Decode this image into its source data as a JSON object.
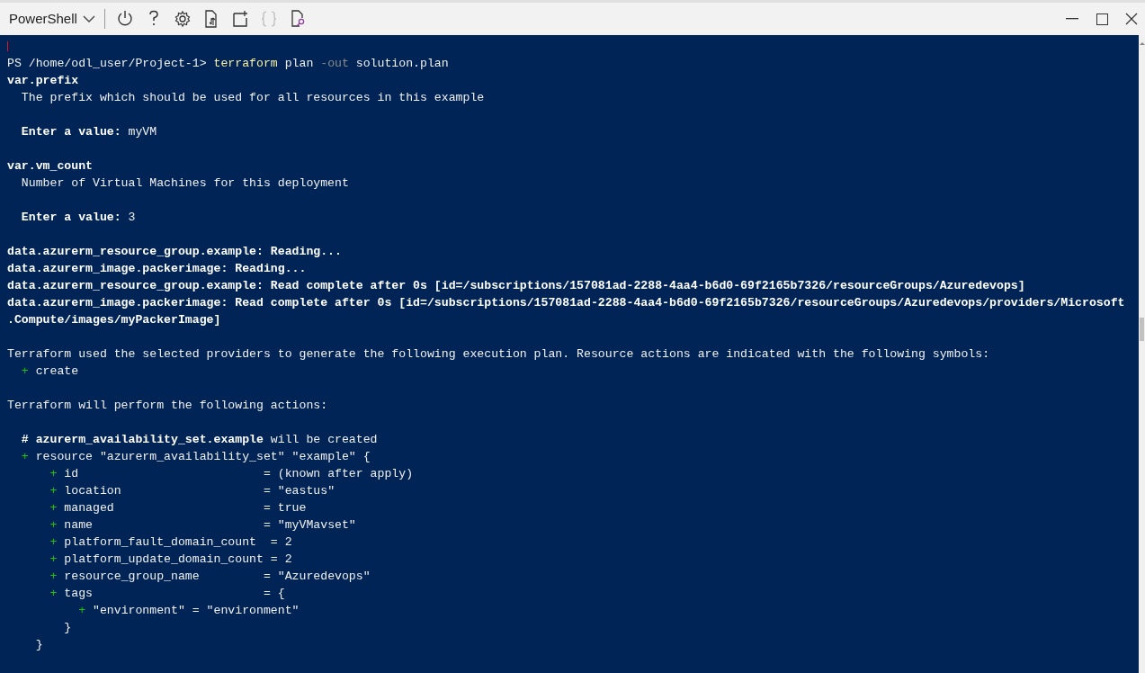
{
  "toolbar": {
    "shell_selector": "PowerShell",
    "buttons": [
      {
        "kind": "power",
        "disabled": false
      },
      {
        "kind": "help",
        "disabled": false
      },
      {
        "kind": "settings",
        "disabled": false
      },
      {
        "kind": "upload",
        "disabled": false
      },
      {
        "kind": "new-session",
        "disabled": false
      },
      {
        "kind": "braces",
        "disabled": true
      },
      {
        "kind": "preview",
        "disabled": false
      }
    ]
  },
  "terminal": {
    "cursor_visible": true,
    "blocks": [
      [
        [
          {
            "text": "PS /home/odl_user/Project-1> ",
            "kind": "plain"
          },
          {
            "text": "terraform",
            "kind": "command"
          },
          {
            "text": " plan ",
            "kind": "plain"
          },
          {
            "text": "-out",
            "kind": "parameter"
          },
          {
            "text": " solution.plan",
            "kind": "plain"
          }
        ],
        [
          {
            "text": "var.prefix",
            "kind": "bold"
          }
        ],
        [
          {
            "text": "  The prefix which should be used for all resources in this example",
            "kind": "plain"
          }
        ]
      ],
      [
        [
          {
            "text": "  Enter a value:",
            "kind": "bold"
          },
          {
            "text": " myVM",
            "kind": "plain"
          }
        ]
      ],
      [
        [
          {
            "text": "var.vm_count",
            "kind": "bold"
          }
        ],
        [
          {
            "text": "  Number of Virtual Machines for this deployment",
            "kind": "plain"
          }
        ]
      ],
      [
        [
          {
            "text": "  Enter a value:",
            "kind": "bold"
          },
          {
            "text": " 3",
            "kind": "plain"
          }
        ]
      ],
      [
        [
          {
            "text": "data.azurerm_resource_group.example: Reading...",
            "kind": "bold"
          }
        ],
        [
          {
            "text": "data.azurerm_image.packerimage: Reading...",
            "kind": "bold"
          }
        ],
        [
          {
            "text": "data.azurerm_resource_group.example: Read complete after 0s [id=/subscriptions/157081ad-2288-4aa4-b6d0-69f2165b7326/resourceGroups/Azuredevops]",
            "kind": "bold"
          }
        ],
        [
          {
            "text": "data.azurerm_image.packerimage: Read complete after 0s [id=/subscriptions/157081ad-2288-4aa4-b6d0-69f2165b7326/resourceGroups/Azuredevops/providers/Microsoft",
            "kind": "bold"
          }
        ],
        [
          {
            "text": ".Compute/images/myPackerImage]",
            "kind": "bold"
          }
        ]
      ],
      [
        [
          {
            "text": "Terraform used the selected providers to generate the following execution plan. Resource actions are indicated with the following symbols:",
            "kind": "plain"
          }
        ],
        [
          {
            "text": "  +",
            "kind": "create"
          },
          {
            "text": " create",
            "kind": "plain"
          }
        ]
      ],
      [
        [
          {
            "text": "Terraform will perform the following actions:",
            "kind": "plain"
          }
        ]
      ],
      [
        [
          {
            "text": "  # azurerm_availability_set.example",
            "kind": "bold"
          },
          {
            "text": " will be created",
            "kind": "plain"
          }
        ],
        [
          {
            "text": "  +",
            "kind": "create"
          },
          {
            "text": " resource \"azurerm_availability_set\" \"example\" {",
            "kind": "plain"
          }
        ],
        [
          {
            "text": "      +",
            "kind": "create"
          },
          {
            "text": " id                          = (known after apply)",
            "kind": "plain"
          }
        ],
        [
          {
            "text": "      +",
            "kind": "create"
          },
          {
            "text": " location                    = \"eastus\"",
            "kind": "plain"
          }
        ],
        [
          {
            "text": "      +",
            "kind": "create"
          },
          {
            "text": " managed                     = true",
            "kind": "plain"
          }
        ],
        [
          {
            "text": "      +",
            "kind": "create"
          },
          {
            "text": " name                        = \"myVMavset\"",
            "kind": "plain"
          }
        ],
        [
          {
            "text": "      +",
            "kind": "create"
          },
          {
            "text": " platform_fault_domain_count  = 2",
            "kind": "plain"
          }
        ],
        [
          {
            "text": "      +",
            "kind": "create"
          },
          {
            "text": " platform_update_domain_count = 2",
            "kind": "plain"
          }
        ],
        [
          {
            "text": "      +",
            "kind": "create"
          },
          {
            "text": " resource_group_name         = \"Azuredevops\"",
            "kind": "plain"
          }
        ],
        [
          {
            "text": "      +",
            "kind": "create"
          },
          {
            "text": " tags                        = {",
            "kind": "plain"
          }
        ],
        [
          {
            "text": "          +",
            "kind": "create"
          },
          {
            "text": " \"environment\" = \"environment\"",
            "kind": "plain"
          }
        ],
        [
          {
            "text": "        }",
            "kind": "plain"
          }
        ],
        [
          {
            "text": "    }",
            "kind": "plain"
          }
        ]
      ]
    ]
  }
}
